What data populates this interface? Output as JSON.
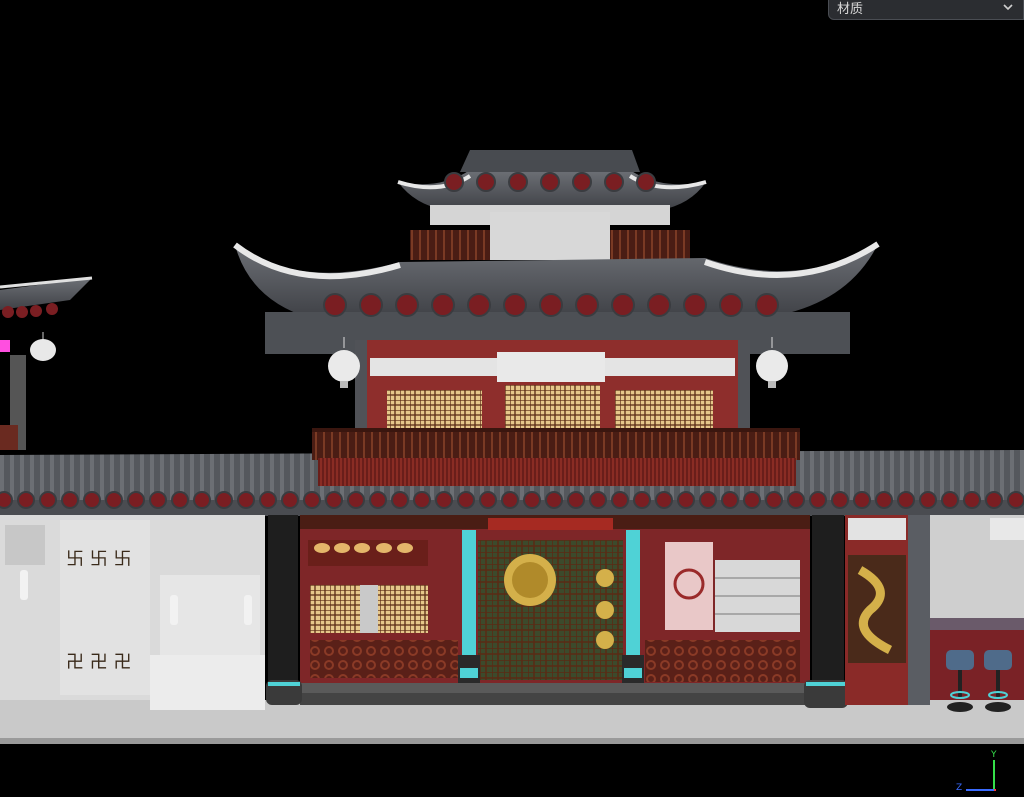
{
  "toolbar": {
    "material_dropdown": {
      "label": "材质",
      "icon": "chevron-down-icon"
    }
  },
  "viewport": {
    "scene": "chinese-pavilion-street",
    "colors": {
      "background": "#000000",
      "roof_tile": "#5a5d63",
      "tile_end": "#7a1e22",
      "wall_red": "#8a2a2a",
      "window_amber": "#e8c889",
      "teal_pillar": "#4fd2d6",
      "gold_dragon": "#d4b04a",
      "white_wall": "#d9d9d9"
    }
  },
  "axis_gizmo": {
    "y_label": "Y",
    "z_label": "Z"
  }
}
